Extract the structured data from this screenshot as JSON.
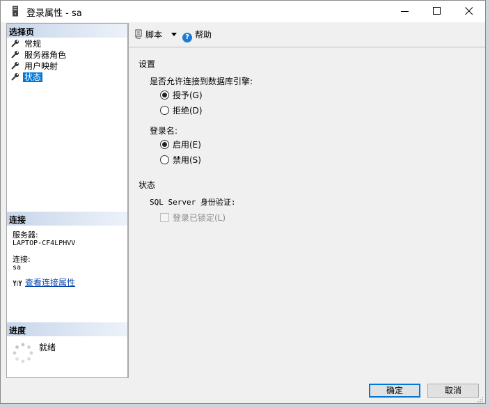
{
  "window": {
    "title": "登录属性 - sa"
  },
  "left": {
    "select_page_header": "选择页",
    "nav_items": [
      {
        "label": "常规"
      },
      {
        "label": "服务器角色"
      },
      {
        "label": "用户映射"
      },
      {
        "label": "状态"
      }
    ],
    "selected_index": 3,
    "connection_header": "连接",
    "server_label": "服务器:",
    "server_value": "LAPTOP-CF4LPHVV",
    "connection_label": "连接:",
    "connection_value": "sa",
    "view_connection_properties": "查看连接属性",
    "progress_header": "进度",
    "progress_status": "就绪"
  },
  "toolbar": {
    "script_label": "脚本",
    "help_label": "帮助"
  },
  "settings": {
    "section_title": "设置",
    "permission_question": "是否允许连接到数据库引擎:",
    "grant_label": "授予(G)",
    "deny_label": "拒绝(D)",
    "permission_value": "grant",
    "login_label": "登录名:",
    "enabled_label": "启用(E)",
    "disabled_label": "禁用(S)",
    "login_value": "enabled"
  },
  "status": {
    "section_title": "状态",
    "auth_label": "SQL Server 身份验证:",
    "locked_label": "登录已锁定(L)",
    "locked_checked": false
  },
  "buttons": {
    "ok_label": "确定",
    "cancel_label": "取消"
  },
  "colors": {
    "selection": "#0078d7",
    "link": "#0645ad",
    "header_gradient": "#c7d6ea"
  }
}
